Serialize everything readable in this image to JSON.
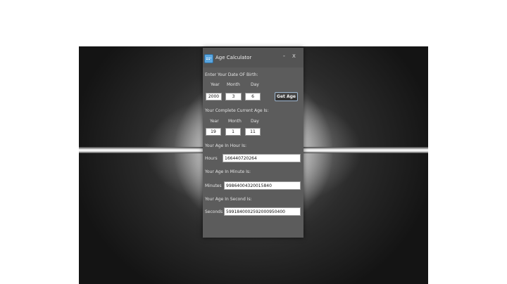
{
  "window": {
    "title": "Age Calculator",
    "minimize": "-",
    "close": "X"
  },
  "dob": {
    "heading": "Enter Your Date OF Birth:",
    "year_label": "Year",
    "month_label": "Month",
    "day_label": "Day",
    "year": "2000",
    "month": "3",
    "day": "6",
    "button": "Get Age"
  },
  "current_age": {
    "heading": "Your Complete Current Age Is:",
    "year_label": "Year",
    "month_label": "Month",
    "day_label": "Day",
    "year": "19",
    "month": "1",
    "day": "11"
  },
  "hours": {
    "heading": "Your Age In Hour Is:",
    "label": "Hours",
    "value": "166440720264"
  },
  "minutes": {
    "heading": "Your Age In Minute Is:",
    "label": "Minutes",
    "value": "99864004320015840"
  },
  "seconds": {
    "heading": "Your Age In Second Is:",
    "label": "Seconds",
    "value": "5991840002592000950400"
  }
}
